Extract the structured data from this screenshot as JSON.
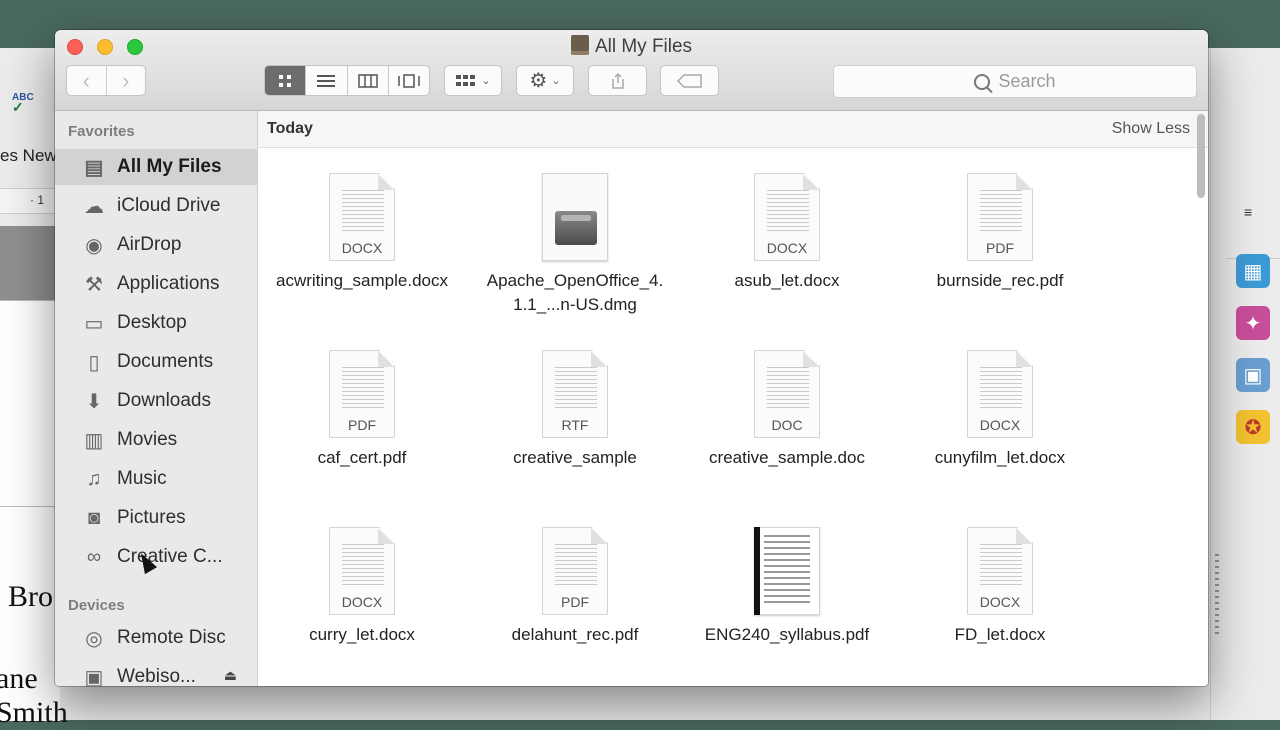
{
  "window": {
    "title": "All My Files"
  },
  "toolbar": {
    "back_icon": "chevron-left",
    "forward_icon": "chevron-right",
    "view_modes": [
      "icon",
      "list",
      "column",
      "cover-flow"
    ],
    "arrange_icon": "arrange",
    "action_icon": "gear",
    "share_icon": "share",
    "tag_icon": "tag",
    "search_placeholder": "Search"
  },
  "sidebar": {
    "favorites_heading": "Favorites",
    "favorites": [
      {
        "label": "All My Files",
        "icon": "all-my-files",
        "selected": true
      },
      {
        "label": "iCloud Drive",
        "icon": "cloud"
      },
      {
        "label": "AirDrop",
        "icon": "airdrop"
      },
      {
        "label": "Applications",
        "icon": "applications"
      },
      {
        "label": "Desktop",
        "icon": "desktop"
      },
      {
        "label": "Documents",
        "icon": "documents"
      },
      {
        "label": "Downloads",
        "icon": "downloads"
      },
      {
        "label": "Movies",
        "icon": "movies"
      },
      {
        "label": "Music",
        "icon": "music"
      },
      {
        "label": "Pictures",
        "icon": "pictures"
      },
      {
        "label": "Creative C...",
        "icon": "creative-cloud"
      }
    ],
    "devices_heading": "Devices",
    "devices": [
      {
        "label": "Remote Disc",
        "icon": "disc"
      },
      {
        "label": "Webiso...",
        "icon": "disk",
        "eject": "⏏"
      }
    ]
  },
  "content": {
    "group_title": "Today",
    "show_less": "Show Less",
    "files": [
      {
        "name": "acwriting_sample.docx",
        "type": "DOCX"
      },
      {
        "name": "Apache_OpenOffice_4.1.1_...n-US.dmg",
        "type": ""
      },
      {
        "name": "asub_let.docx",
        "type": "DOCX"
      },
      {
        "name": "burnside_rec.pdf",
        "type": "PDF"
      },
      {
        "name": "caf_cert.pdf",
        "type": "PDF"
      },
      {
        "name": "creative_sample",
        "type": "RTF"
      },
      {
        "name": "creative_sample.doc",
        "type": "DOC"
      },
      {
        "name": "cunyfilm_let.docx",
        "type": "DOCX"
      },
      {
        "name": "curry_let.docx",
        "type": "DOCX"
      },
      {
        "name": "delahunt_rec.pdf",
        "type": "PDF"
      },
      {
        "name": "ENG240_syllabus.pdf",
        "type": ""
      },
      {
        "name": "FD_let.docx",
        "type": "DOCX"
      }
    ]
  },
  "background_app": {
    "spell_label": "ABC",
    "font_name": "es New",
    "ruler_mark": "·  1",
    "text_1": "Bro",
    "text_2": "ane Smith"
  }
}
